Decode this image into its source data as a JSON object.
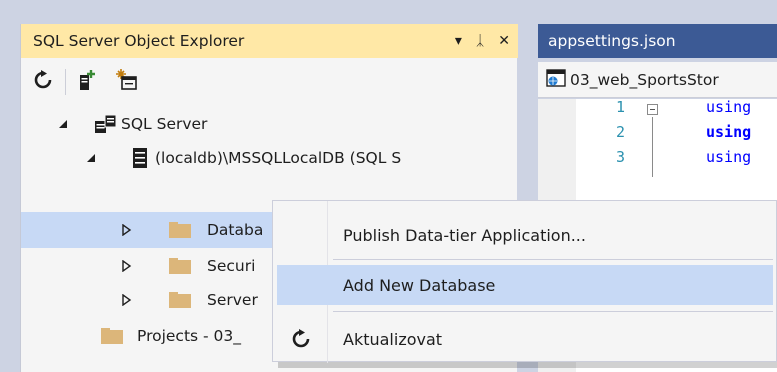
{
  "soe": {
    "title": "SQL Server Object Explorer",
    "title_buttons": {
      "dropdown": "▾",
      "pin": "ᛣ",
      "close": "✕"
    },
    "toolbar": {
      "refresh_icon": "refresh-icon",
      "add_server_icon": "add-sql-server-icon",
      "new_query_icon": "new-query-icon"
    },
    "tree": [
      {
        "label": "SQL Server",
        "icon": "sql-server-icon",
        "expanded": true
      },
      {
        "label": "(localdb)\\MSSQLLocalDB (SQL S",
        "icon": "server-instance-icon",
        "expanded": true
      },
      {
        "label": "Databa",
        "icon": "folder-icon",
        "expanded": false,
        "selected": true
      },
      {
        "label": "Securi",
        "icon": "folder-icon",
        "expanded": false
      },
      {
        "label": "Server",
        "icon": "folder-icon",
        "expanded": false
      },
      {
        "label": "Projects - 03_",
        "icon": "folder-icon"
      }
    ]
  },
  "editor": {
    "tab_label": "appsettings.json",
    "nav_label": "03_web_SportsStor",
    "lines": [
      {
        "num": "1",
        "text": "using"
      },
      {
        "num": "2",
        "text": "using"
      },
      {
        "num": "3",
        "text": "using"
      }
    ]
  },
  "context_menu": {
    "items": [
      {
        "label": "Publish Data-tier Application..."
      },
      {
        "label": "Add New Database",
        "hovered": true
      },
      {
        "label": "Aktualizovat",
        "icon": "refresh-icon"
      }
    ]
  },
  "colors": {
    "accent_title": "#ffe8a6",
    "selection": "#c7d9f5",
    "tab_bar": "#3c5a95"
  }
}
